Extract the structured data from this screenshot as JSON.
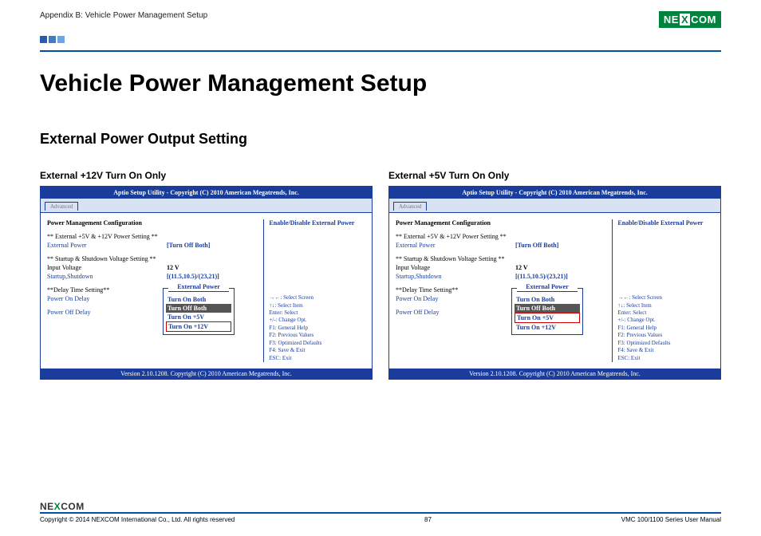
{
  "header": {
    "breadcrumb": "Appendix B: Vehicle Power Management Setup",
    "logo_text_pre": "NE",
    "logo_text_x": "X",
    "logo_text_post": "COM"
  },
  "page": {
    "title": "Vehicle Power Management Setup",
    "section": "External Power Output Setting"
  },
  "panel_a": {
    "label": "External +12V Turn On Only",
    "selected_index": 3
  },
  "panel_b": {
    "label": "External +5V Turn On Only",
    "selected_index": 2
  },
  "bios": {
    "titlebar": "Aptio Setup Utility - Copyright (C) 2010 American Megatrends, Inc.",
    "tab": "Advanced",
    "section_head": "Power Management Configuration",
    "row_power_header": "** External +5V & +12V Power Setting **",
    "row_ext_power_k": "External Power",
    "row_ext_power_v": "[Turn Off Both]",
    "row_startup_header": "** Startup & Shutdown Voltage Setting **",
    "row_input_k": "Input Voltage",
    "row_input_v": "12 V",
    "row_ss_k": "Startup,Shutdown",
    "row_ss_v": "[(11.5,10.5)/(23,21)]",
    "row_delay_header": "**Delay Time Setting**",
    "row_pon_k": "Power On Delay",
    "row_poff_k": "Power Off Delay",
    "right_top": "Enable/Disable External Power",
    "help": [
      "→←: Select Screen",
      "↑↓: Select Item",
      "Enter: Select",
      "+/-: Change Opt.",
      "F1: General Help",
      "F2: Previous Values",
      "F3: Optimized Defaults",
      "F4: Save & Exit",
      "ESC: Exit"
    ],
    "footer": "Version 2.10.1208. Copyright (C) 2010 American Megatrends, Inc."
  },
  "popup": {
    "title": "External Power",
    "items": [
      "Turn On Both",
      "Turn Off Both",
      "Turn On +5V",
      "Turn On +12V"
    ]
  },
  "footer": {
    "logo_pre": "NE",
    "logo_x": "X",
    "logo_post": "COM",
    "copyright": "Copyright © 2014 NEXCOM International Co., Ltd. All rights reserved",
    "page_no": "87",
    "manual": "VMC 100/1100 Series User Manual"
  }
}
